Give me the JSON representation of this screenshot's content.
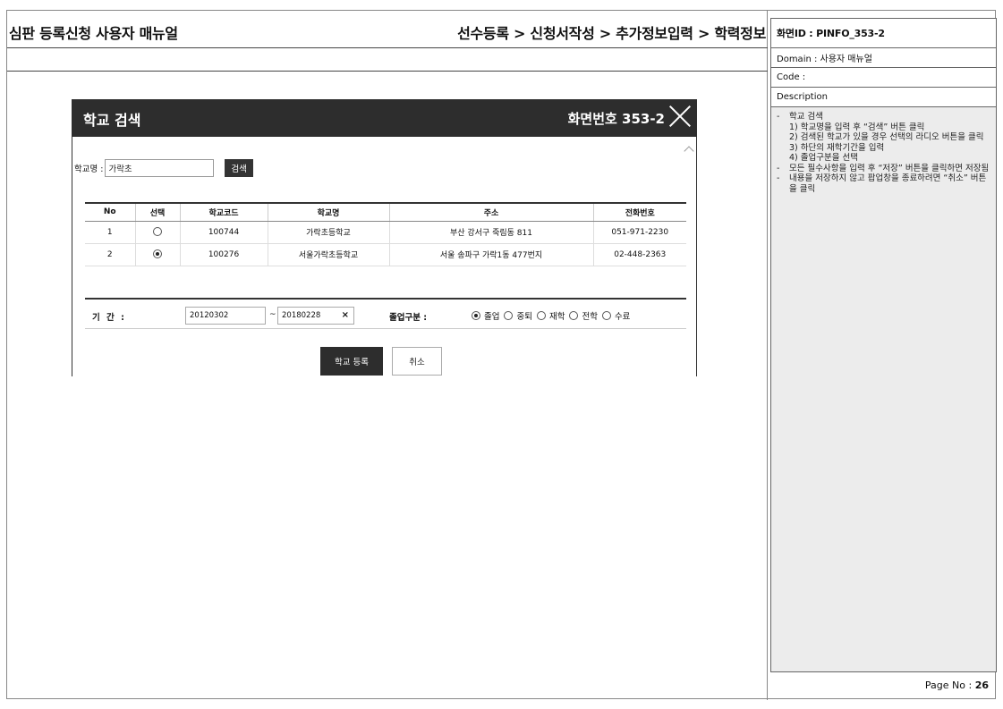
{
  "doc": {
    "title": "심판 등록신청 사용자 매뉴얼",
    "breadcrumb": "선수등록 > 신청서작성 > 추가정보입력 > 학력정보"
  },
  "side": {
    "screen_id": "화면ID : PINFO_353-2",
    "domain": "Domain : 사용자 매뉴얼",
    "code": "Code :",
    "description_label": "Description",
    "description": [
      {
        "dash": "-",
        "text": "학교 검색",
        "sub": [
          "1) 학교명을 입력 후 “검색” 버튼 클릭",
          "2) 검색된 학교가 있을 경우 선택의 라디오 버튼을 클릭",
          "3) 하단의 재학기간을 입력",
          "4) 졸업구분을 선택"
        ]
      },
      {
        "dash": "-",
        "text": "모든 필수사항을 입력 후 “저장” 버튼을 클릭하면 저장됨",
        "sub": []
      },
      {
        "dash": "-",
        "text": "내용을 저장하지 않고 팝업창을 종료하려면 “취소” 버튼을 클릭",
        "sub": []
      }
    ],
    "page_label": "Page No :",
    "page_number": "26"
  },
  "dialog": {
    "title": "학교 검색",
    "screen_no": "화면번호 353-2",
    "search_label": "학교명 :",
    "search_value": "가락초",
    "search_button": "검색",
    "columns": [
      "No",
      "선택",
      "학교코드",
      "학교명",
      "주소",
      "전화번호"
    ],
    "rows": [
      {
        "no": "1",
        "selected": false,
        "code": "100744",
        "name": "가락초등학교",
        "address": "부산 강서구 죽림동 811",
        "phone": "051-971-2230"
      },
      {
        "no": "2",
        "selected": true,
        "code": "100276",
        "name": "서울가락초등학교",
        "address": "서울 송파구 가락1동 477번지",
        "phone": "02-448-2363"
      }
    ],
    "period_label": "기 간 :",
    "date_from": "20120302",
    "tilde": "~",
    "date_to": "20180228",
    "clear_glyph": "×",
    "grad_label": "졸업구분 :",
    "grad_options": [
      {
        "label": "졸업",
        "selected": true
      },
      {
        "label": "중퇴",
        "selected": false
      },
      {
        "label": "재학",
        "selected": false
      },
      {
        "label": "전학",
        "selected": false
      },
      {
        "label": "수료",
        "selected": false
      }
    ],
    "register_button": "학교 등록",
    "cancel_button": "취소"
  }
}
